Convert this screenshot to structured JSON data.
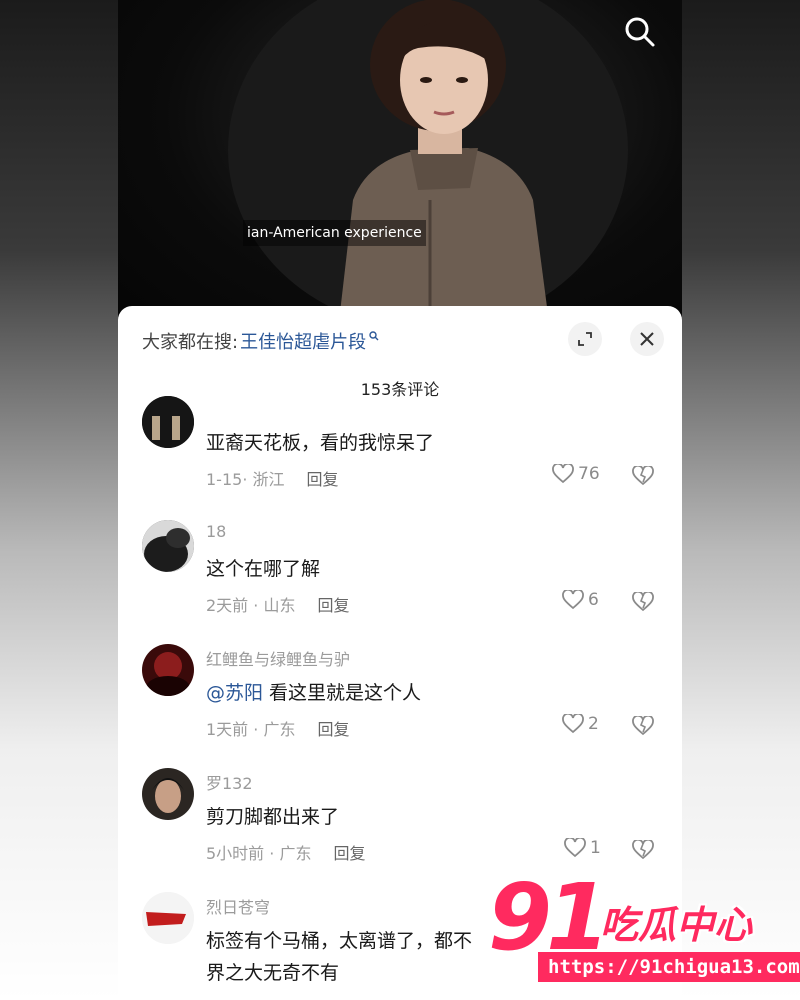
{
  "video": {
    "subtitle": "ian-American experience"
  },
  "sheet": {
    "trend_prefix": "大家都在搜:",
    "trend_keyword": "王佳怡超虐片段",
    "comment_count": "153条评论"
  },
  "comments": [
    {
      "name": "",
      "text": "亚裔天花板，看的我惊呆了",
      "meta": "1-15· 浙江",
      "reply": "回复",
      "likes": "76"
    },
    {
      "name": "18",
      "text": "这个在哪了解",
      "meta": "2天前 · 山东",
      "reply": "回复",
      "likes": "6"
    },
    {
      "name": "红鲤鱼与绿鲤鱼与驴",
      "mention": "@苏阳",
      "text": " 看这里就是这个人",
      "meta": "1天前 · 广东",
      "reply": "回复",
      "likes": "2"
    },
    {
      "name": "罗132",
      "text": "剪刀脚都出来了",
      "meta": "5小时前 · 广东",
      "reply": "回复",
      "likes": "1"
    },
    {
      "name": "烈日苍穹",
      "text": "标签有个马桶，太离谱了，都不",
      "text2": "界之大无奇不有",
      "meta": "",
      "reply": "",
      "likes": ""
    }
  ],
  "watermark": {
    "number": "91",
    "brand": "吃瓜中心",
    "url": "https://91chigua13.com"
  },
  "colors": {
    "link_blue": "#2b5797",
    "watermark_pink": "#ff2a5f"
  }
}
